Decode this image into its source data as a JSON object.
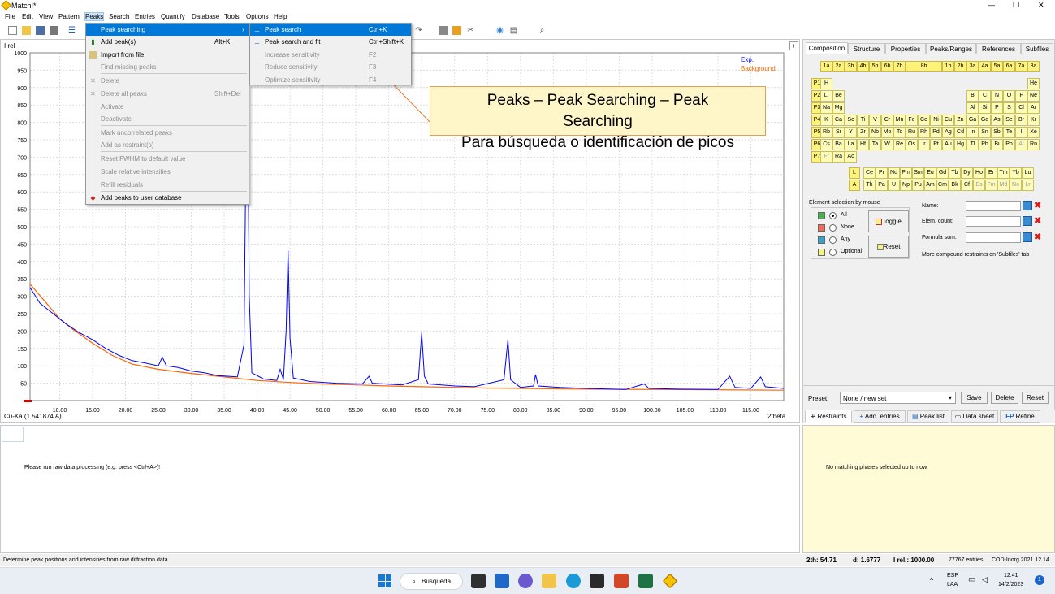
{
  "window": {
    "title": "Match!*",
    "controls": [
      "—",
      "❐",
      "✕"
    ]
  },
  "menubar": [
    "File",
    "Edit",
    "View",
    "Pattern",
    "Peaks",
    "Search",
    "Entries",
    "Quantify",
    "Database",
    "Tools",
    "Options",
    "Help"
  ],
  "peaks_menu": {
    "items": [
      {
        "label": "Peak searching",
        "shortcut": "",
        "disabled": false,
        "highlight": true,
        "arrow": "›"
      },
      {
        "label": "Add peak(s)",
        "shortcut": "Alt+K",
        "disabled": false
      },
      {
        "label": "Import from file",
        "shortcut": "",
        "disabled": false
      },
      {
        "label": "Find missing peaks",
        "shortcut": "",
        "disabled": true
      },
      {
        "label": "Delete",
        "shortcut": "",
        "disabled": true
      },
      {
        "label": "Delete all peaks",
        "shortcut": "Shift+Del",
        "disabled": true
      },
      {
        "label": "Activate",
        "shortcut": "",
        "disabled": true
      },
      {
        "label": "Deactivate",
        "shortcut": "",
        "disabled": true
      },
      {
        "label": "Mark uncorrelated peaks",
        "shortcut": "",
        "disabled": true
      },
      {
        "label": "Add as restraint(s)",
        "shortcut": "",
        "disabled": true
      },
      {
        "label": "Reset FWHM to default value",
        "shortcut": "",
        "disabled": true
      },
      {
        "label": "Scale relative intensities",
        "shortcut": "",
        "disabled": true
      },
      {
        "label": "Refill residuals",
        "shortcut": "",
        "disabled": true
      },
      {
        "label": "Add peaks to user database",
        "shortcut": "",
        "disabled": false
      }
    ]
  },
  "submenu": {
    "items": [
      {
        "label": "Peak search",
        "shortcut": "Ctrl+K",
        "disabled": false,
        "highlight": true
      },
      {
        "label": "Peak search and fit",
        "shortcut": "Ctrl+Shift+K",
        "disabled": false
      },
      {
        "label": "Increase sensitivity",
        "shortcut": "F2",
        "disabled": true
      },
      {
        "label": "Reduce sensitivity",
        "shortcut": "F3",
        "disabled": true
      },
      {
        "label": "Optimize sensitivity",
        "shortcut": "F4",
        "disabled": true
      }
    ]
  },
  "callout": {
    "line1": "Peaks – Peak Searching – Peak",
    "line2": "Searching",
    "line3": "Para búsqueda o identificación de picos"
  },
  "chart": {
    "ylabel_top": "I rel",
    "xlabel": "2theta",
    "wavelength": "Cu-Ka (1.541874 A)",
    "legend": {
      "exp": "Exp.",
      "background": "Background"
    },
    "plus": "+"
  },
  "chart_data": {
    "type": "line",
    "xlim": [
      5.5,
      120
    ],
    "ylim": [
      0,
      1000
    ],
    "xticks": [
      10,
      15,
      20,
      25,
      30,
      35,
      40,
      45,
      50,
      55,
      60,
      65,
      70,
      75,
      80,
      85,
      90,
      95,
      100,
      105,
      110,
      115
    ],
    "xtick_labels": [
      "10.00",
      "15.00",
      "20.00",
      "25.00",
      "30.00",
      "35.00",
      "40.00",
      "45.00",
      "50.00",
      "55.00",
      "60.00",
      "65.00",
      "70.00",
      "75.00",
      "80.00",
      "85.00",
      "90.00",
      "95.00",
      "100.00",
      "105.00",
      "110.00",
      "115.00"
    ],
    "yticks": [
      50,
      100,
      150,
      200,
      250,
      300,
      350,
      400,
      450,
      500,
      550,
      600,
      650,
      700,
      750,
      800,
      850,
      900,
      950,
      1000
    ],
    "series": [
      {
        "name": "Exp.",
        "color": "#0000ff",
        "points": [
          [
            5.5,
            325
          ],
          [
            7,
            280
          ],
          [
            9,
            250
          ],
          [
            11,
            220
          ],
          [
            13,
            195
          ],
          [
            15,
            175
          ],
          [
            17,
            150
          ],
          [
            19,
            130
          ],
          [
            21,
            115
          ],
          [
            23,
            108
          ],
          [
            25,
            100
          ],
          [
            25.6,
            125
          ],
          [
            26.2,
            100
          ],
          [
            28,
            95
          ],
          [
            30,
            85
          ],
          [
            32,
            80
          ],
          [
            34,
            72
          ],
          [
            35.5,
            70
          ],
          [
            37,
            68
          ],
          [
            38,
            160
          ],
          [
            38.3,
            700
          ],
          [
            38.5,
            1000
          ],
          [
            38.8,
            300
          ],
          [
            39.2,
            80
          ],
          [
            41,
            62
          ],
          [
            43,
            58
          ],
          [
            43.5,
            90
          ],
          [
            44,
            60
          ],
          [
            44.4,
            200
          ],
          [
            44.7,
            432
          ],
          [
            45,
            180
          ],
          [
            45.5,
            65
          ],
          [
            48,
            55
          ],
          [
            52,
            50
          ],
          [
            56,
            48
          ],
          [
            57,
            70
          ],
          [
            57.5,
            50
          ],
          [
            62,
            45
          ],
          [
            64.5,
            60
          ],
          [
            65,
            195
          ],
          [
            65.4,
            70
          ],
          [
            66,
            48
          ],
          [
            70,
            42
          ],
          [
            73,
            40
          ],
          [
            77.5,
            60
          ],
          [
            78.1,
            175
          ],
          [
            78.5,
            60
          ],
          [
            80,
            38
          ],
          [
            82,
            42
          ],
          [
            82.3,
            75
          ],
          [
            82.7,
            42
          ],
          [
            86,
            38
          ],
          [
            90,
            35
          ],
          [
            96,
            32
          ],
          [
            98.8,
            48
          ],
          [
            99.5,
            35
          ],
          [
            104,
            33
          ],
          [
            110,
            32
          ],
          [
            111.8,
            70
          ],
          [
            112.6,
            38
          ],
          [
            115,
            35
          ],
          [
            116.5,
            68
          ],
          [
            117.2,
            40
          ],
          [
            120,
            35
          ]
        ]
      },
      {
        "name": "Background",
        "color": "#ff6600",
        "points": [
          [
            5.5,
            335
          ],
          [
            8,
            280
          ],
          [
            10,
            235
          ],
          [
            12,
            205
          ],
          [
            15,
            165
          ],
          [
            18,
            130
          ],
          [
            21,
            105
          ],
          [
            25,
            90
          ],
          [
            30,
            78
          ],
          [
            35,
            68
          ],
          [
            40,
            58
          ],
          [
            45,
            52
          ],
          [
            50,
            48
          ],
          [
            55,
            45
          ],
          [
            60,
            42
          ],
          [
            65,
            40
          ],
          [
            70,
            38
          ],
          [
            75,
            36
          ],
          [
            80,
            35
          ],
          [
            90,
            33
          ],
          [
            100,
            32
          ],
          [
            110,
            31
          ],
          [
            120,
            30
          ]
        ]
      }
    ]
  },
  "right_tabs": [
    "Composition",
    "Structure",
    "Properties",
    "Peaks/Ranges",
    "References",
    "Subfiles"
  ],
  "group_labels": [
    "1a",
    "2a",
    "3b",
    "4b",
    "5b",
    "6b",
    "7b",
    "8b",
    "1b",
    "2b",
    "3a",
    "4a",
    "5a",
    "6a",
    "7a",
    "8a"
  ],
  "period_labels": [
    "P1",
    "P2",
    "P3",
    "P4",
    "P5",
    "P6",
    "P7"
  ],
  "periods": [
    [
      {
        "s": "H",
        "c": 1
      },
      {
        "s": "He",
        "c": 18
      }
    ],
    [
      {
        "s": "Li",
        "c": 1
      },
      {
        "s": "Be",
        "c": 2
      },
      {
        "s": "B",
        "c": 13
      },
      {
        "s": "C",
        "c": 14
      },
      {
        "s": "N",
        "c": 15
      },
      {
        "s": "O",
        "c": 16
      },
      {
        "s": "F",
        "c": 17
      },
      {
        "s": "Ne",
        "c": 18
      }
    ],
    [
      {
        "s": "Na",
        "c": 1
      },
      {
        "s": "Mg",
        "c": 2
      },
      {
        "s": "Al",
        "c": 13
      },
      {
        "s": "Si",
        "c": 14
      },
      {
        "s": "P",
        "c": 15
      },
      {
        "s": "S",
        "c": 16
      },
      {
        "s": "Cl",
        "c": 17
      },
      {
        "s": "Ar",
        "c": 18
      }
    ],
    [
      "K",
      "Ca",
      "Sc",
      "Ti",
      "V",
      "Cr",
      "Mn",
      "Fe",
      "Co",
      "Ni",
      "Cu",
      "Zn",
      "Ga",
      "Ge",
      "As",
      "Se",
      "Br",
      "Kr"
    ],
    [
      "Rb",
      "Sr",
      "Y",
      "Zr",
      "Nb",
      "Mo",
      "Tc",
      "Ru",
      "Rh",
      "Pd",
      "Ag",
      "Cd",
      "In",
      "Sn",
      "Sb",
      "Te",
      "I",
      "Xe"
    ],
    [
      "Cs",
      "Ba",
      "La",
      "Hf",
      "Ta",
      "W",
      "Re",
      "Os",
      "Ir",
      "Pt",
      "Au",
      "Hg",
      "Tl",
      "Pb",
      "Bi",
      "Po",
      "At",
      "Rn"
    ],
    [
      {
        "s": "Fr",
        "c": 1,
        "d": true
      },
      {
        "s": "Ra",
        "c": 2
      },
      {
        "s": "Ac",
        "c": 3
      }
    ]
  ],
  "lanthanides": {
    "label": "L",
    "els": [
      "Ce",
      "Pr",
      "Nd",
      "Pm",
      "Sm",
      "Eu",
      "Gd",
      "Tb",
      "Dy",
      "Ho",
      "Er",
      "Tm",
      "Yb",
      "Lu"
    ]
  },
  "actinides": {
    "label": "A",
    "els": [
      "Th",
      "Pa",
      "U",
      "Np",
      "Pu",
      "Am",
      "Cm",
      "Bk",
      "Cf",
      "Es",
      "Fm",
      "Md",
      "No",
      "Lr"
    ],
    "disabled": [
      "Es",
      "Fm",
      "Md",
      "No",
      "Lr"
    ]
  },
  "selection": {
    "title": "Element selection by mouse",
    "options": [
      {
        "label": "All",
        "color": "#4caf50"
      },
      {
        "label": "None",
        "color": "#ef6c5a"
      },
      {
        "label": "Any",
        "color": "#3aa0c8"
      },
      {
        "label": "Optional",
        "color": "#f6f28a"
      }
    ],
    "toggle": "Toggle",
    "reset": "Reset"
  },
  "restraints": {
    "name": "Name:",
    "elem_count": "Elem. count:",
    "formula_sum": "Formula sum:",
    "more": "More compound restraints on 'Subfiles' tab"
  },
  "preset": {
    "label": "Preset:",
    "value": "None / new set",
    "save": "Save",
    "delete": "Delete",
    "reset": "Reset"
  },
  "bottom_tabs": [
    "Restraints",
    "Add. entries",
    "Peak list",
    "Data sheet",
    "Refine"
  ],
  "bottom_left_msg": "Please run raw data processing (e.g. press <Ctrl+A>)!",
  "bottom_right_msg": "No matching phases selected up to now.",
  "status": {
    "left": "Determine peak positions and intensities from raw diffraction data",
    "twoth": "2th:  54.71",
    "d": "d: 1.6777",
    "irel": "I rel.: 1000.00",
    "entries": "77767 entries",
    "db": "COD-Inorg 2021.12.14"
  },
  "taskbar": {
    "search": "Búsqueda",
    "lang1": "ESP",
    "lang2": "LAA",
    "time": "12:41",
    "date": "14/2/2023",
    "notif": "1"
  }
}
